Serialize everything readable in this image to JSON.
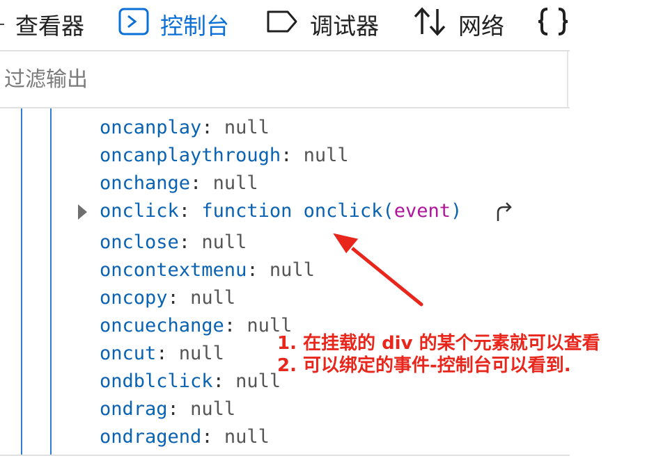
{
  "tabs": [
    {
      "label": "查看器",
      "icon": "inspector-icon",
      "active": false
    },
    {
      "label": "控制台",
      "icon": "console-icon",
      "active": true
    },
    {
      "label": "调试器",
      "icon": "debugger-icon",
      "active": false
    },
    {
      "label": "网络",
      "icon": "network-icon",
      "active": false
    },
    {
      "label": "",
      "icon": "style-editor-icon",
      "active": false
    }
  ],
  "filter": {
    "placeholder": "过滤输出",
    "value": ""
  },
  "properties": [
    {
      "key": "oncanplay",
      "value": "null"
    },
    {
      "key": "oncanplaythrough",
      "value": "null"
    },
    {
      "key": "onchange",
      "value": "null"
    },
    {
      "key": "onclick",
      "value_keyword": "function",
      "value_name": "onclick",
      "value_param": "event",
      "expandable": true
    },
    {
      "key": "onclose",
      "value": "null"
    },
    {
      "key": "oncontextmenu",
      "value": "null"
    },
    {
      "key": "oncopy",
      "value": "null"
    },
    {
      "key": "oncuechange",
      "value": "null"
    },
    {
      "key": "oncut",
      "value": "null"
    },
    {
      "key": "ondblclick",
      "value": "null"
    },
    {
      "key": "ondrag",
      "value": "null"
    },
    {
      "key": "ondragend",
      "value": "null"
    }
  ],
  "annotation": {
    "line1": "1. 在挂载的 div 的某个元素就可以查看",
    "line2": "2. 可以绑定的事件-控制台可以看到."
  },
  "colors": {
    "accent": "#0a6fd6",
    "annotation": "#e8261c",
    "key": "#0a62b3",
    "param": "#b0149d"
  }
}
